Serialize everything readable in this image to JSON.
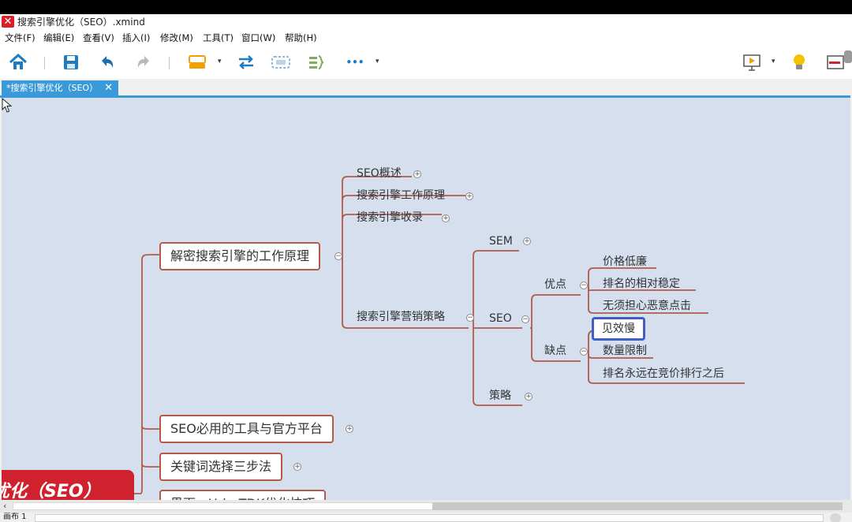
{
  "window": {
    "title": "搜索引擎优化（SEO）.xmind",
    "app_logo_glyph": "✕"
  },
  "menu": {
    "items": [
      "文件(F)",
      "编辑(E)",
      "查看(V)",
      "插入(I)",
      "修改(M)",
      "工具(T)",
      "窗口(W)",
      "帮助(H)"
    ]
  },
  "toolbar": {
    "icons": [
      "home-icon",
      "save-icon",
      "undo-icon",
      "redo-icon",
      "topic-style-icon",
      "relationship-icon",
      "boundary-icon",
      "summary-icon",
      "more-icon",
      "presentation-icon",
      "idea-icon",
      "panel-icon"
    ],
    "caret_glyph": "▾",
    "more_glyph": "•••",
    "colors": {
      "accent_blue": "#1f7bc1",
      "orange": "#f1a000",
      "bulb_yellow": "#f6c200"
    }
  },
  "tabs": [
    {
      "label": "*搜索引擎优化（SEO）",
      "close": "✕"
    }
  ],
  "mindmap": {
    "central": "擎优化（SEO）",
    "branches": [
      {
        "label": "解密搜索引擎的工作原理",
        "children": [
          {
            "label": "SEO概述"
          },
          {
            "label": "搜索引擎工作原理"
          },
          {
            "label": "搜索引擎收录"
          },
          {
            "label": "搜索引擎营销策略",
            "children": [
              {
                "label": "SEM"
              },
              {
                "label": "SEO",
                "children": [
                  {
                    "label": "优点",
                    "children": [
                      "价格低廉",
                      "排名的相对稳定",
                      "无须担心恶意点击"
                    ]
                  },
                  {
                    "label": "缺点",
                    "children": [
                      "见效慢",
                      "数量限制",
                      "排名永远在竞价排行之后"
                    ]
                  }
                ]
              },
              {
                "label": "策略"
              }
            ]
          }
        ]
      },
      {
        "label": "SEO必用的工具与官方平台"
      },
      {
        "label": "关键词选择三步法"
      },
      {
        "label": "界面、Url、TDK优化技巧"
      }
    ],
    "selected_topic": "见效慢",
    "expand_glyph": "+",
    "collapse_glyph": "−",
    "colors": {
      "branch_line": "#b35a4b",
      "canvas_bg": "#d5dfee",
      "central_bg": "#d0222e",
      "selection": "#3f5fc8"
    }
  },
  "scrollbar": {
    "left_arrow": "‹"
  },
  "status": {
    "sheet_label": "画布 1"
  }
}
